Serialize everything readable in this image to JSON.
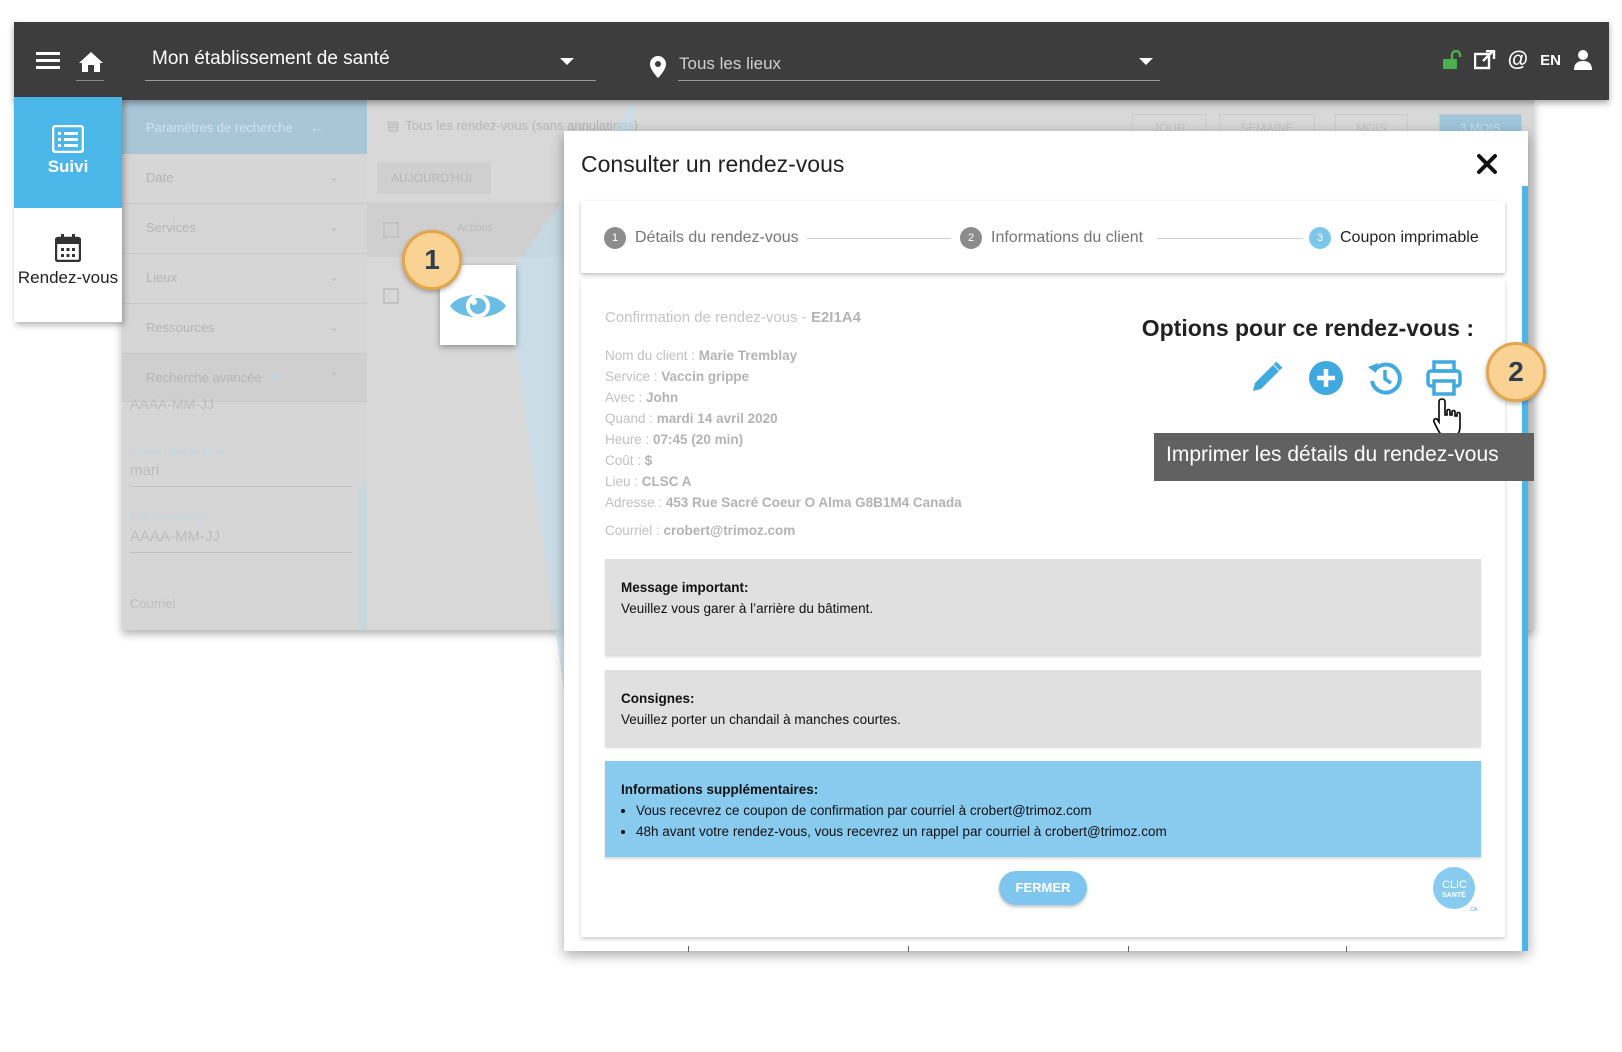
{
  "topbar": {
    "establishment": "Mon établissement de santé",
    "locations_placeholder": "Tous les lieux",
    "language": "EN"
  },
  "leftnav": {
    "suivi": "Suivi",
    "rendezvous": "Rendez-vous"
  },
  "background": {
    "panel_title": "Paramètres de recherche",
    "filters": [
      "Date",
      "Services",
      "Lieux",
      "Ressources",
      "Recherche avancée"
    ],
    "date_placeholder_top": "AAAA-MM-JJ",
    "client_name_label": "Prénom / Nom du client",
    "client_name_value": "mari",
    "birth_label": "Date de naissance",
    "birth_placeholder": "AAAA-MM-JJ",
    "courriel_label": "Courriel",
    "list_filter": "Tous les rendez-vous (sans annulations)",
    "views": [
      "JOUR",
      "SEMAINE",
      "MOIS",
      "3 MOIS"
    ],
    "today_button": "AUJOURD'HUI",
    "actions_header": "Actions"
  },
  "callouts": [
    "1",
    "2"
  ],
  "modal": {
    "title": "Consulter un rendez-vous",
    "steps": [
      {
        "num": "1",
        "label": "Détails du rendez-vous"
      },
      {
        "num": "2",
        "label": "Informations du client"
      },
      {
        "num": "3",
        "label": "Coupon imprimable"
      }
    ],
    "confirmation_label": "Confirmation de rendez-vous - ",
    "confirmation_code": "E2I1A4",
    "details": [
      {
        "label": "Nom du client : ",
        "value": "Marie Tremblay"
      },
      {
        "label": "Service : ",
        "value": "Vaccin grippe"
      },
      {
        "label": "Avec : ",
        "value": "John"
      },
      {
        "label": "Quand : ",
        "value": "mardi 14 avril 2020"
      },
      {
        "label": "Heure : ",
        "value": "07:45 (20 min)"
      },
      {
        "label": "Coût : ",
        "value": "$"
      },
      {
        "label": "Lieu : ",
        "value": "CLSC A"
      },
      {
        "label": "Adresse : ",
        "value": "453 Rue Sacré Coeur O Alma G8B1M4 Canada"
      }
    ],
    "email_label": "Courriel : ",
    "email_value": "crobert@trimoz.com",
    "options_title": "Options pour ce rendez-vous :",
    "option_icons": [
      "pencil-icon",
      "plus-circle-icon",
      "history-icon",
      "print-icon"
    ],
    "tooltip": "Imprimer les détails du rendez-vous",
    "important_title": "Message important:",
    "important_text": "Veuillez vous garer à l’arrière du bâtiment.",
    "consignes_title": "Consignes:",
    "consignes_text": "Veuillez porter un chandail à manches courtes.",
    "info_title": "Informations supplémentaires:",
    "info_items": [
      "Vous recevrez ce coupon de confirmation par courriel à crobert@trimoz.com",
      "48h avant votre rendez-vous, vous recevrez un rappel par courriel à crobert@trimoz.com"
    ],
    "close_button": "FERMER",
    "logo_text_1": "CLIC",
    "logo_text_2": "SANTÉ",
    "logo_text_3": ".CA"
  },
  "colors": {
    "accent": "#4bb7e8",
    "topbar": "#3d3d3d",
    "callout_fill": "#fad394",
    "callout_border": "#e3a64a",
    "info_box": "#88cbef",
    "lock_green": "#4caf50"
  }
}
